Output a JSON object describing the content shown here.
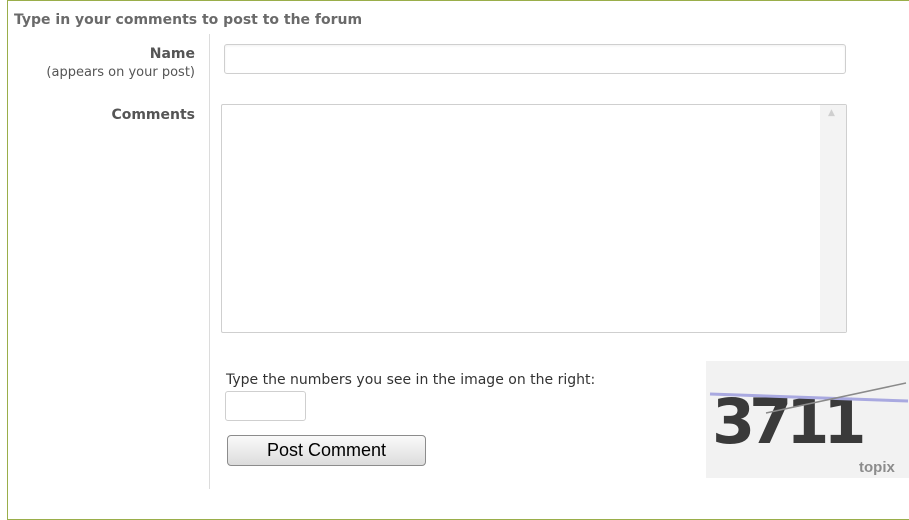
{
  "form": {
    "heading": "Type in your comments to post to the forum",
    "name_label": "Name",
    "name_sublabel": "(appears on your post)",
    "name_value": "",
    "comments_label": "Comments",
    "comments_value": "",
    "captcha_instruction": "Type the numbers you see in the image on the right:",
    "captcha_value": "",
    "submit_label": "Post Comment"
  },
  "captcha_image": {
    "text": "3711",
    "brand": "topix"
  },
  "colors": {
    "border": "#9aae4a",
    "heading_text": "#6a6a6a"
  }
}
